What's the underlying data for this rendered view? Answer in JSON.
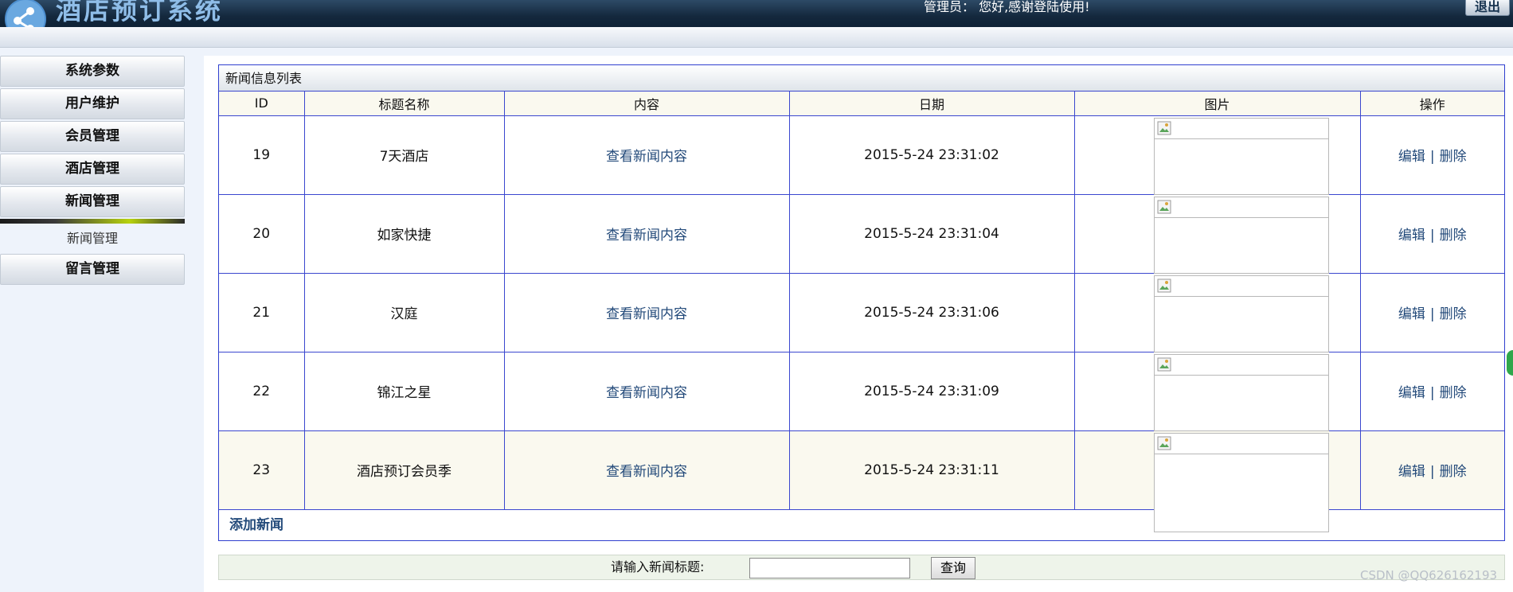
{
  "header": {
    "app_title": "酒店预订系统",
    "admin_greeting": "管理员：  您好,感谢登陆使用!",
    "logout_label": "退出"
  },
  "sidebar": {
    "items": [
      {
        "label": "系统参数"
      },
      {
        "label": "用户维护"
      },
      {
        "label": "会员管理"
      },
      {
        "label": "酒店管理"
      },
      {
        "label": "新闻管理",
        "active": true
      }
    ],
    "submenu": {
      "label": "新闻管理"
    },
    "after_items": [
      {
        "label": "留言管理"
      }
    ]
  },
  "panel": {
    "title": "新闻信息列表",
    "columns": [
      "ID",
      "标题名称",
      "内容",
      "日期",
      "图片",
      "操作"
    ],
    "rows": [
      {
        "id": "19",
        "title": "7天酒店",
        "content_link": "查看新闻内容",
        "date": "2015-5-24 23:31:02",
        "edit": "编辑",
        "delete": "删除"
      },
      {
        "id": "20",
        "title": "如家快捷",
        "content_link": "查看新闻内容",
        "date": "2015-5-24 23:31:04",
        "edit": "编辑",
        "delete": "删除"
      },
      {
        "id": "21",
        "title": "汉庭",
        "content_link": "查看新闻内容",
        "date": "2015-5-24 23:31:06",
        "edit": "编辑",
        "delete": "删除"
      },
      {
        "id": "22",
        "title": "锦江之星",
        "content_link": "查看新闻内容",
        "date": "2015-5-24 23:31:09",
        "edit": "编辑",
        "delete": "删除"
      },
      {
        "id": "23",
        "title": "酒店预订会员季",
        "content_link": "查看新闻内容",
        "date": "2015-5-24 23:31:11",
        "edit": "编辑",
        "delete": "删除"
      }
    ],
    "separator": "|",
    "add_label": "添加新闻"
  },
  "search": {
    "label": "请输入新闻标题:",
    "value": "",
    "placeholder": "",
    "button_label": "查询"
  },
  "watermark": "CSDN @QQ626162193",
  "colors": {
    "header_bg": "#14283d",
    "table_border": "#3a47cf",
    "link": "#234a7a",
    "alt_row": "#faf9ef"
  }
}
